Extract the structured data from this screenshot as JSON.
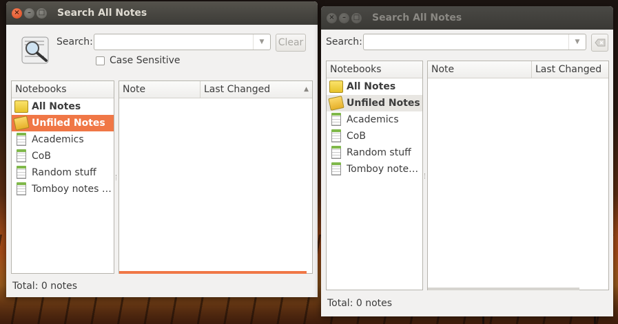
{
  "window_left": {
    "title": "Search All Notes",
    "search_label": "Search:",
    "search_value": "",
    "clear_label": "Clear",
    "case_sensitive_label": "Case Sensitive",
    "notebooks_header": "Notebooks",
    "note_col": "Note",
    "last_changed_col": "Last Changed",
    "sort_indicator": "▲",
    "notebooks": [
      {
        "label": "All Notes",
        "icon": "folder-icon",
        "bold": true
      },
      {
        "label": "Unfiled Notes",
        "icon": "open-folder-icon",
        "bold": true,
        "selected": true
      },
      {
        "label": "Academics",
        "icon": "notebook-icon"
      },
      {
        "label": "CoB",
        "icon": "notebook-icon"
      },
      {
        "label": "Random stuff",
        "icon": "notebook-icon"
      },
      {
        "label": "Tomboy notes …",
        "icon": "notebook-icon"
      }
    ],
    "status": "Total: 0 notes",
    "progress": 1.0,
    "accent": "#f07746"
  },
  "window_right": {
    "title": "Search All Notes",
    "search_label": "Search:",
    "search_value": "",
    "notebooks_header": "Notebooks",
    "note_col": "Note",
    "last_changed_col": "Last Changed",
    "notebooks": [
      {
        "label": "All Notes",
        "icon": "folder-icon",
        "bold": true
      },
      {
        "label": "Unfiled Notes",
        "icon": "open-folder-icon",
        "bold": true,
        "selected": true
      },
      {
        "label": "Academics",
        "icon": "notebook-icon"
      },
      {
        "label": "CoB",
        "icon": "notebook-icon"
      },
      {
        "label": "Random stuff",
        "icon": "notebook-icon"
      },
      {
        "label": "Tomboy note…",
        "icon": "notebook-icon"
      }
    ],
    "status": "Total: 0 notes"
  },
  "window_buttons": {
    "close": "×",
    "minimize": "–",
    "maximize": "□"
  }
}
